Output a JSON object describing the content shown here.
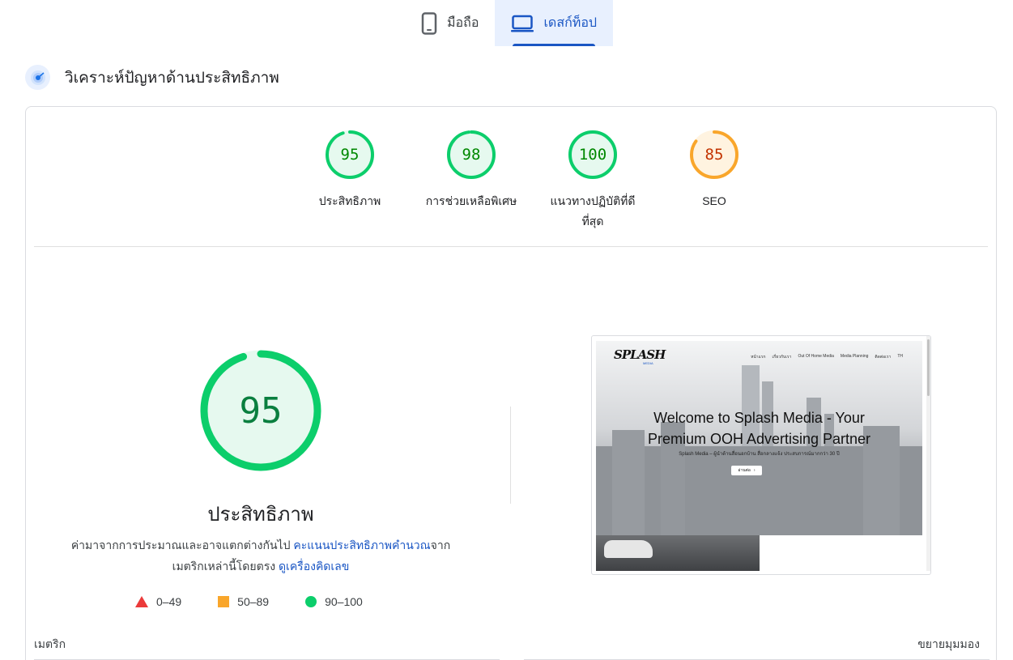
{
  "tabs": [
    {
      "label": "มือถือ",
      "icon": "phone-icon",
      "active": false
    },
    {
      "label": "เดสก์ท็อป",
      "icon": "laptop-icon",
      "active": true
    }
  ],
  "section": {
    "title": "วิเคราะห์ปัญหาด้านประสิทธิภาพ",
    "icon": "performance-radar-icon"
  },
  "colors": {
    "pass": "#0cce6b",
    "pass_text": "#008800",
    "average": "#f9a62b",
    "average_text": "#c33300",
    "fail": "#eb3a3a",
    "accent": "#1a56c4"
  },
  "scores": [
    {
      "label": "ประสิทธิภาพ",
      "value": "95",
      "score": 95,
      "rating": "pass"
    },
    {
      "label": "การช่วยเหลือพิเศษ",
      "value": "98",
      "score": 98,
      "rating": "pass"
    },
    {
      "label": "แนวทางปฏิบัติที่ดีที่สุด",
      "value": "100",
      "score": 100,
      "rating": "pass"
    },
    {
      "label": "SEO",
      "value": "85",
      "score": 85,
      "rating": "average"
    }
  ],
  "main": {
    "score": "95",
    "score_value": 95,
    "title": "ประสิทธิภาพ",
    "desc_prefix": "ค่ามาจากการประมาณและอาจแตกต่างกันไป ",
    "desc_link1": "คะแนนประสิทธิภาพคำนวณ",
    "desc_mid": "จากเมตริกเหล่านี้โดยตรง ",
    "desc_link2": "ดูเครื่องคิดเลข"
  },
  "legend": [
    {
      "shape": "triangle",
      "label": "0–49"
    },
    {
      "shape": "square",
      "label": "50–89"
    },
    {
      "shape": "circle",
      "label": "90–100"
    }
  ],
  "screenshot": {
    "logo": "SPLASH",
    "logo_sub": "MEDIA",
    "nav_links": [
      "หน้าแรก",
      "เกี่ยวกับเรา",
      "Out Of Home Media",
      "Media Planning",
      "ติดต่อเรา",
      "TH"
    ],
    "headline_1": "Welcome to Splash Media - Your",
    "headline_2": "Premium OOH Advertising Partner",
    "subline": "Splash Media – ผู้นำด้านสื่อนอกบ้าน สื่อกลางแจ้ง ประสบการณ์มากกว่า 30 ปี",
    "button": "อ่านต่อ"
  },
  "footer": {
    "metrics_label": "เมตริก",
    "expand_label": "ขยายมุมมอง"
  }
}
